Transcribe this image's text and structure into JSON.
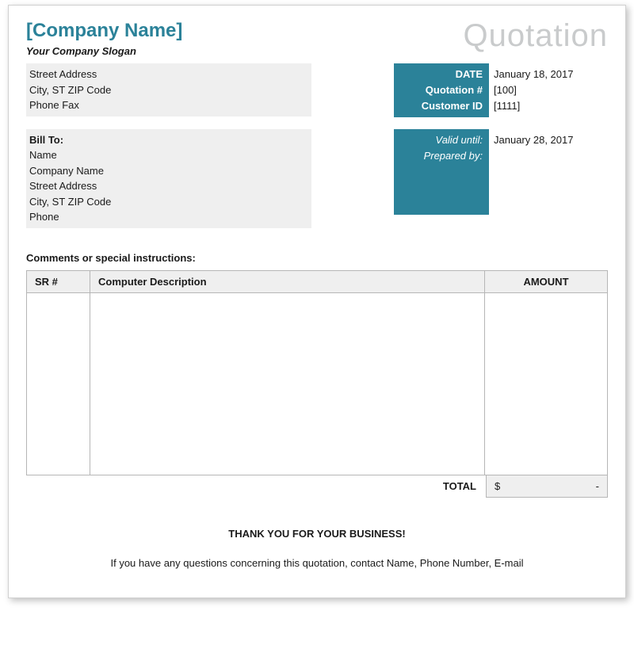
{
  "header": {
    "company_name": "[Company Name]",
    "slogan": "Your Company Slogan",
    "doc_title": "Quotation"
  },
  "company_address": {
    "line1": "Street Address",
    "line2": "City, ST  ZIP Code",
    "line3": "Phone    Fax"
  },
  "quote_meta": {
    "date_label": "DATE",
    "date_value": "January 18, 2017",
    "num_label": "Quotation #",
    "num_value": "[100]",
    "cust_label": "Customer ID",
    "cust_value": "[1111]"
  },
  "bill_to": {
    "heading": "Bill To:",
    "line1": "Name",
    "line2": "Company Name",
    "line3": "Street Address",
    "line4": "City, ST  ZIP Code",
    "line5": "Phone"
  },
  "validity": {
    "valid_label": "Valid until:",
    "valid_value": "January 28, 2017",
    "prep_label": "Prepared by:",
    "prep_value": ""
  },
  "comments_heading": "Comments or special instructions:",
  "table": {
    "col_sr": "SR #",
    "col_desc": "Computer Description",
    "col_amt": "AMOUNT"
  },
  "totals": {
    "label": "TOTAL",
    "currency": "$",
    "value": "-"
  },
  "thanks": "THANK YOU FOR YOUR BUSINESS!",
  "footer": "If you have any questions concerning this quotation, contact Name, Phone Number, E-mail"
}
